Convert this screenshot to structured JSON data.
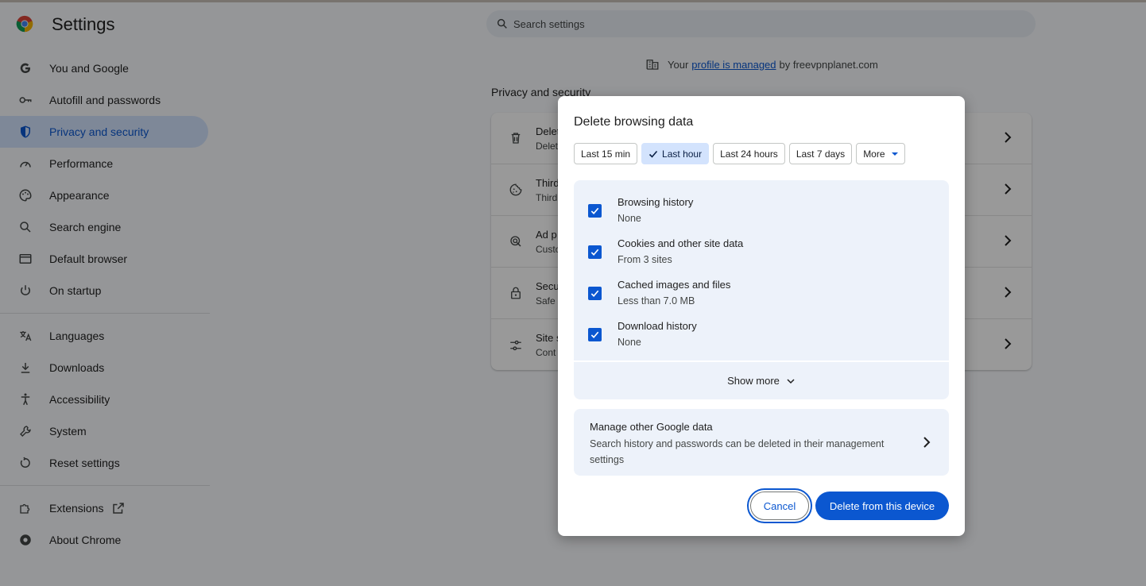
{
  "header": {
    "title": "Settings",
    "search_placeholder": "Search settings"
  },
  "sidebar": {
    "items": [
      {
        "label": "You and Google",
        "icon": "google-icon"
      },
      {
        "label": "Autofill and passwords",
        "icon": "key-icon"
      },
      {
        "label": "Privacy and security",
        "icon": "shield-icon",
        "active": true
      },
      {
        "label": "Performance",
        "icon": "speedometer-icon"
      },
      {
        "label": "Appearance",
        "icon": "palette-icon"
      },
      {
        "label": "Search engine",
        "icon": "search-icon"
      },
      {
        "label": "Default browser",
        "icon": "browser-window-icon"
      },
      {
        "label": "On startup",
        "icon": "power-icon"
      },
      {
        "label": "Languages",
        "icon": "translate-icon"
      },
      {
        "label": "Downloads",
        "icon": "download-icon"
      },
      {
        "label": "Accessibility",
        "icon": "accessibility-icon"
      },
      {
        "label": "System",
        "icon": "wrench-icon"
      },
      {
        "label": "Reset settings",
        "icon": "reset-icon"
      },
      {
        "label": "Extensions",
        "icon": "puzzle-icon"
      },
      {
        "label": "About Chrome",
        "icon": "chrome-icon"
      }
    ]
  },
  "main": {
    "managed_prefix": "Your",
    "managed_link": "profile is managed",
    "managed_suffix": "by freevpnplanet.com",
    "section_title": "Privacy and security",
    "rows": [
      {
        "title": "Delet",
        "subtitle": "Delet",
        "icon": "trash-icon"
      },
      {
        "title": "Third",
        "subtitle": "Third",
        "icon": "cookie-icon"
      },
      {
        "title": "Ad p",
        "subtitle": "Custo",
        "icon": "ad-privacy-icon"
      },
      {
        "title": "Secu",
        "subtitle": "Safe",
        "icon": "lock-icon"
      },
      {
        "title": "Site s",
        "subtitle": "Cont",
        "icon": "sliders-icon"
      }
    ]
  },
  "dialog": {
    "title": "Delete browsing data",
    "time_ranges": [
      "Last 15 min",
      "Last hour",
      "Last 24 hours",
      "Last 7 days",
      "More"
    ],
    "selected_range": "Last hour",
    "items": [
      {
        "name": "Browsing history",
        "detail": "None",
        "checked": true
      },
      {
        "name": "Cookies and other site data",
        "detail": "From 3 sites",
        "checked": true
      },
      {
        "name": "Cached images and files",
        "detail": "Less than 7.0 MB",
        "checked": true
      },
      {
        "name": "Download history",
        "detail": "None",
        "checked": true
      }
    ],
    "show_more": "Show more",
    "google_data_title": "Manage other Google data",
    "google_data_desc": "Search history and passwords can be deleted in their management settings",
    "cancel": "Cancel",
    "delete": "Delete from this device"
  },
  "colors": {
    "accent": "#0b57d0",
    "active_nav_bg": "#d3e3fd",
    "panel_bg": "#edf2fa"
  }
}
